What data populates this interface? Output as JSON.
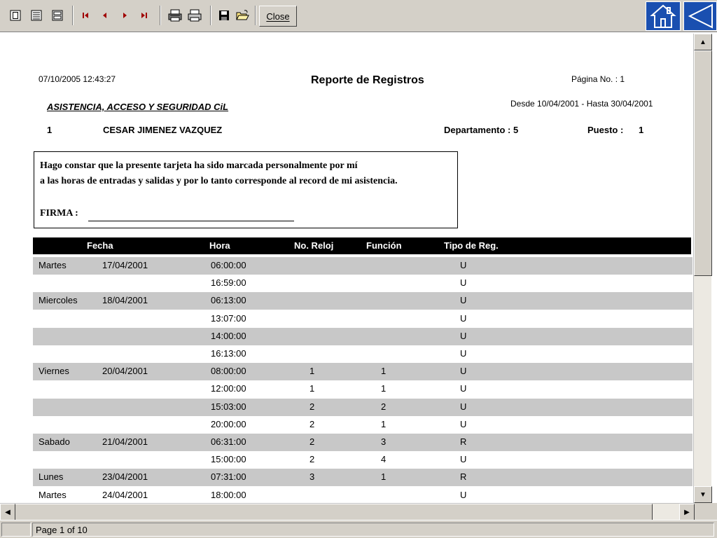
{
  "toolbar": {
    "close_label": "Close"
  },
  "report": {
    "printed_at": "07/10/2005 12:43:27",
    "title": "Reporte de Registros",
    "page_label": "Página No. : 1",
    "company": "ASISTENCIA, ACCESO Y SEGURIDAD CiL",
    "date_range": "Desde 10/04/2001 - Hasta 30/04/2001",
    "employee_id": "1",
    "employee_name": "CESAR JIMENEZ VAZQUEZ",
    "department_label": "Departamento : 5",
    "position_label": "Puesto :",
    "position_value": "1",
    "declaration_line1": "Hago constar que la presente tarjeta ha sido marcada personalmente por mí",
    "declaration_line2": "a las horas de entradas y salidas y por lo tanto corresponde al record de mi asistencia.",
    "signature_label": "FIRMA :"
  },
  "table": {
    "headers": {
      "fecha": "Fecha",
      "hora": "Hora",
      "reloj": "No. Reloj",
      "funcion": "Función",
      "tipo": "Tipo de Reg."
    },
    "rows": [
      {
        "day": "Martes",
        "date": "17/04/2001",
        "time": "06:00:00",
        "clock": "",
        "function": "",
        "type": "U"
      },
      {
        "day": "",
        "date": "",
        "time": "16:59:00",
        "clock": "",
        "function": "",
        "type": "U"
      },
      {
        "day": "Miercoles",
        "date": "18/04/2001",
        "time": "06:13:00",
        "clock": "",
        "function": "",
        "type": "U"
      },
      {
        "day": "",
        "date": "",
        "time": "13:07:00",
        "clock": "",
        "function": "",
        "type": "U"
      },
      {
        "day": "",
        "date": "",
        "time": "14:00:00",
        "clock": "",
        "function": "",
        "type": "U"
      },
      {
        "day": "",
        "date": "",
        "time": "16:13:00",
        "clock": "",
        "function": "",
        "type": "U"
      },
      {
        "day": "Viernes",
        "date": "20/04/2001",
        "time": "08:00:00",
        "clock": "1",
        "function": "1",
        "type": "U"
      },
      {
        "day": "",
        "date": "",
        "time": "12:00:00",
        "clock": "1",
        "function": "1",
        "type": "U"
      },
      {
        "day": "",
        "date": "",
        "time": "15:03:00",
        "clock": "2",
        "function": "2",
        "type": "U"
      },
      {
        "day": "",
        "date": "",
        "time": "20:00:00",
        "clock": "2",
        "function": "1",
        "type": "U"
      },
      {
        "day": "Sabado",
        "date": "21/04/2001",
        "time": "06:31:00",
        "clock": "2",
        "function": "3",
        "type": "R"
      },
      {
        "day": "",
        "date": "",
        "time": "15:00:00",
        "clock": "2",
        "function": "4",
        "type": "U"
      },
      {
        "day": "Lunes",
        "date": "23/04/2001",
        "time": "07:31:00",
        "clock": "3",
        "function": "1",
        "type": "R"
      },
      {
        "day": "Martes",
        "date": "24/04/2001",
        "time": "18:00:00",
        "clock": "",
        "function": "",
        "type": "U"
      }
    ]
  },
  "status": {
    "page_info": "Page 1 of 10"
  },
  "colors": {
    "nav_accent": "#a00000",
    "home_button": "#1a4fb0",
    "row_shade": "#c8c8c8"
  },
  "icons": [
    "one-page-icon",
    "two-page-icon",
    "fit-page-icon",
    "first-page-icon",
    "prev-page-icon",
    "next-page-icon",
    "last-page-icon",
    "print-setup-icon",
    "print-icon",
    "save-icon",
    "open-icon",
    "home-icon",
    "back-icon"
  ]
}
